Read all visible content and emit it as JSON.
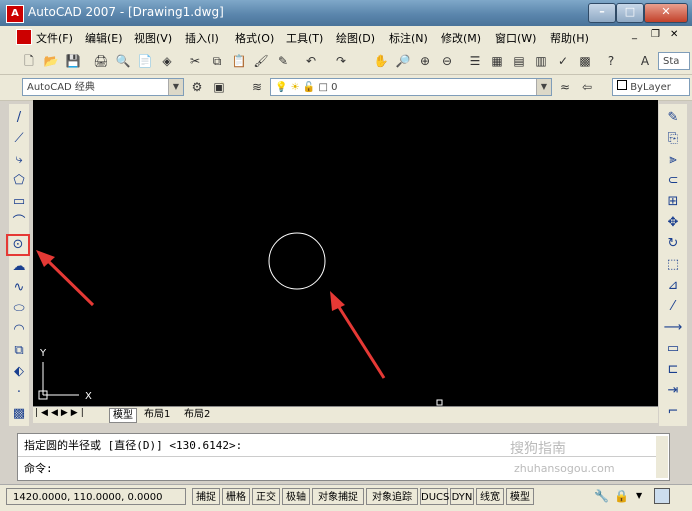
{
  "window": {
    "title": "AutoCAD 2007 - [Drawing1.dwg]",
    "app_icon": "autocad-logo"
  },
  "menu": [
    {
      "label": "文件(F)"
    },
    {
      "label": "编辑(E)"
    },
    {
      "label": "视图(V)"
    },
    {
      "label": "插入(I)"
    },
    {
      "label": "格式(O)"
    },
    {
      "label": "工具(T)"
    },
    {
      "label": "绘图(D)"
    },
    {
      "label": "标注(N)"
    },
    {
      "label": "修改(M)"
    },
    {
      "label": "窗口(W)"
    },
    {
      "label": "帮助(H)"
    }
  ],
  "toolbar": {
    "workspace": "AutoCAD 经典",
    "layer": "0",
    "color": "ByLayer",
    "text_style_partial": "Sta"
  },
  "tabs": [
    "模型",
    "布局1",
    "布局2"
  ],
  "command": {
    "line1": "指定圆的半径或 [直径(D)] <130.6142>:",
    "line2": "命令:"
  },
  "status": {
    "coords": "1420.0000, 110.0000, 0.0000",
    "buttons": [
      "捕捉",
      "栅格",
      "正交",
      "极轴",
      "对象捕捉",
      "对象追踪",
      "DUCS",
      "DYN",
      "线宽",
      "模型"
    ]
  },
  "ucs": {
    "x_label": "X",
    "y_label": "Y"
  },
  "watermark": "zhuhansogou.com",
  "colors": {
    "annotation": "#e53935",
    "canvas": "#000000"
  }
}
